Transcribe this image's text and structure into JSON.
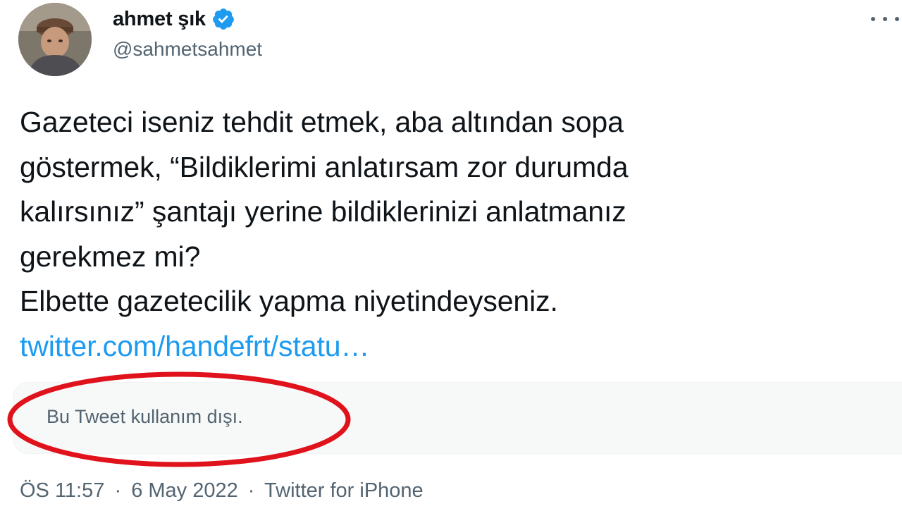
{
  "author": {
    "display_name": "ahmet şık",
    "handle": "@sahmetsahmet",
    "verified": true,
    "avatar_icon": "user-photo-avatar"
  },
  "menu": {
    "icon": "more-options-icon"
  },
  "tweet": {
    "lines": [
      "Gazeteci iseniz tehdit etmek, aba altından sopa",
      "göstermek, “Bildiklerimi anlatırsam zor durumda",
      "kalırsınız” şantajı yerine bildiklerinizi anlatmanız",
      "gerekmez mi?",
      "Elbette gazetecilik yapma niyetindeyseniz."
    ],
    "link_text": "twitter.com/handefrt/statu…"
  },
  "quoted_tweet": {
    "unavailable_text": "Bu Tweet kullanım dışı."
  },
  "meta": {
    "time": "ÖS 11:57",
    "date": "6 May 2022",
    "source": "Twitter for iPhone",
    "separator": "·"
  },
  "colors": {
    "link": "#1d9bf0",
    "verified_badge": "#1d9bf0",
    "secondary_text": "#536471",
    "annotation_ellipse": "#e0121c"
  }
}
